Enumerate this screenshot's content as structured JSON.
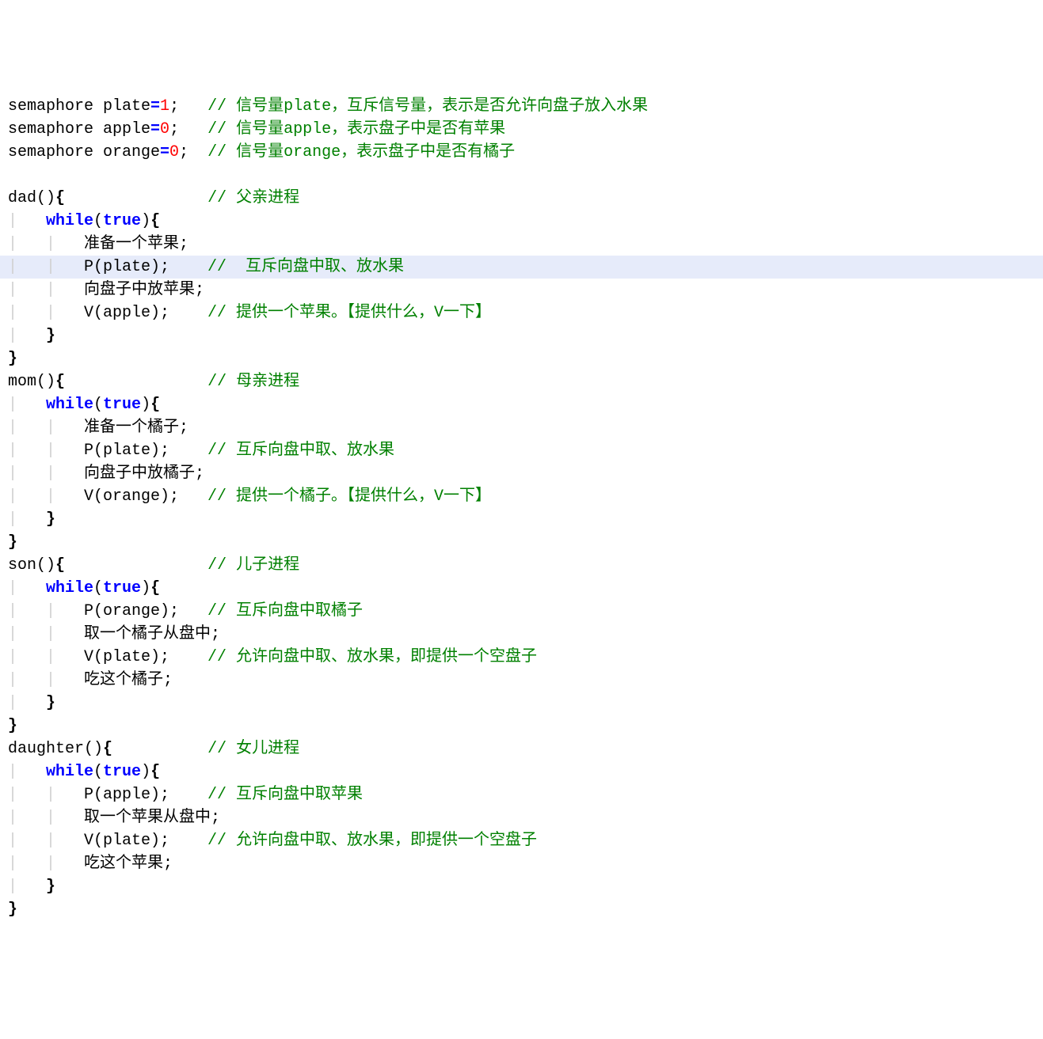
{
  "lines": [
    {
      "indent": 0,
      "highlighted": false,
      "tokens": [
        {
          "t": "identifier",
          "v": "semaphore plate"
        },
        {
          "t": "operator",
          "v": "="
        },
        {
          "t": "number",
          "v": "1"
        },
        {
          "t": "punct",
          "v": ";   "
        },
        {
          "t": "comment",
          "v": "// 信号量plate，互斥信号量，表示是否允许向盘子放入水果"
        }
      ]
    },
    {
      "indent": 0,
      "highlighted": false,
      "tokens": [
        {
          "t": "identifier",
          "v": "semaphore apple"
        },
        {
          "t": "operator",
          "v": "="
        },
        {
          "t": "number",
          "v": "0"
        },
        {
          "t": "punct",
          "v": ";   "
        },
        {
          "t": "comment",
          "v": "// 信号量apple，表示盘子中是否有苹果"
        }
      ]
    },
    {
      "indent": 0,
      "highlighted": false,
      "tokens": [
        {
          "t": "identifier",
          "v": "semaphore orange"
        },
        {
          "t": "operator",
          "v": "="
        },
        {
          "t": "number",
          "v": "0"
        },
        {
          "t": "punct",
          "v": ";  "
        },
        {
          "t": "comment",
          "v": "// 信号量orange，表示盘子中是否有橘子"
        }
      ]
    },
    {
      "indent": 0,
      "highlighted": false,
      "tokens": []
    },
    {
      "indent": 0,
      "highlighted": false,
      "tokens": [
        {
          "t": "identifier",
          "v": "dad"
        },
        {
          "t": "punct",
          "v": "()"
        },
        {
          "t": "brace",
          "v": "{"
        },
        {
          "t": "punct",
          "v": "               "
        },
        {
          "t": "comment",
          "v": "// 父亲进程"
        }
      ]
    },
    {
      "indent": 1,
      "highlighted": false,
      "tokens": [
        {
          "t": "keyword",
          "v": "while"
        },
        {
          "t": "punct",
          "v": "("
        },
        {
          "t": "keyword",
          "v": "true"
        },
        {
          "t": "punct",
          "v": ")"
        },
        {
          "t": "brace",
          "v": "{"
        }
      ]
    },
    {
      "indent": 2,
      "highlighted": false,
      "tokens": [
        {
          "t": "identifier",
          "v": "准备一个苹果;"
        }
      ]
    },
    {
      "indent": 2,
      "highlighted": true,
      "tokens": [
        {
          "t": "identifier",
          "v": "P(plate);    "
        },
        {
          "t": "comment",
          "v": "//  互斥向盘中取、放水果"
        }
      ]
    },
    {
      "indent": 2,
      "highlighted": false,
      "tokens": [
        {
          "t": "identifier",
          "v": "向盘子中放苹果;"
        }
      ]
    },
    {
      "indent": 2,
      "highlighted": false,
      "tokens": [
        {
          "t": "identifier",
          "v": "V(apple);    "
        },
        {
          "t": "comment",
          "v": "// 提供一个苹果。【提供什么，V一下】"
        }
      ]
    },
    {
      "indent": 1,
      "highlighted": false,
      "tokens": [
        {
          "t": "brace",
          "v": "}"
        }
      ]
    },
    {
      "indent": 0,
      "highlighted": false,
      "tokens": [
        {
          "t": "brace",
          "v": "}"
        }
      ]
    },
    {
      "indent": 0,
      "highlighted": false,
      "tokens": [
        {
          "t": "identifier",
          "v": "mom"
        },
        {
          "t": "punct",
          "v": "()"
        },
        {
          "t": "brace",
          "v": "{"
        },
        {
          "t": "punct",
          "v": "               "
        },
        {
          "t": "comment",
          "v": "// 母亲进程"
        }
      ]
    },
    {
      "indent": 1,
      "highlighted": false,
      "tokens": [
        {
          "t": "keyword",
          "v": "while"
        },
        {
          "t": "punct",
          "v": "("
        },
        {
          "t": "keyword",
          "v": "true"
        },
        {
          "t": "punct",
          "v": ")"
        },
        {
          "t": "brace",
          "v": "{"
        }
      ]
    },
    {
      "indent": 2,
      "highlighted": false,
      "tokens": [
        {
          "t": "identifier",
          "v": "准备一个橘子;"
        }
      ]
    },
    {
      "indent": 2,
      "highlighted": false,
      "tokens": [
        {
          "t": "identifier",
          "v": "P(plate);    "
        },
        {
          "t": "comment",
          "v": "// 互斥向盘中取、放水果"
        }
      ]
    },
    {
      "indent": 2,
      "highlighted": false,
      "tokens": [
        {
          "t": "identifier",
          "v": "向盘子中放橘子;"
        }
      ]
    },
    {
      "indent": 2,
      "highlighted": false,
      "tokens": [
        {
          "t": "identifier",
          "v": "V(orange);   "
        },
        {
          "t": "comment",
          "v": "// 提供一个橘子。【提供什么，V一下】"
        }
      ]
    },
    {
      "indent": 1,
      "highlighted": false,
      "tokens": [
        {
          "t": "brace",
          "v": "}"
        }
      ]
    },
    {
      "indent": 0,
      "highlighted": false,
      "tokens": [
        {
          "t": "brace",
          "v": "}"
        }
      ]
    },
    {
      "indent": 0,
      "highlighted": false,
      "tokens": [
        {
          "t": "identifier",
          "v": "son"
        },
        {
          "t": "punct",
          "v": "()"
        },
        {
          "t": "brace",
          "v": "{"
        },
        {
          "t": "punct",
          "v": "               "
        },
        {
          "t": "comment",
          "v": "// 儿子进程"
        }
      ]
    },
    {
      "indent": 1,
      "highlighted": false,
      "tokens": [
        {
          "t": "keyword",
          "v": "while"
        },
        {
          "t": "punct",
          "v": "("
        },
        {
          "t": "keyword",
          "v": "true"
        },
        {
          "t": "punct",
          "v": ")"
        },
        {
          "t": "brace",
          "v": "{"
        }
      ]
    },
    {
      "indent": 2,
      "highlighted": false,
      "tokens": [
        {
          "t": "identifier",
          "v": "P(orange);   "
        },
        {
          "t": "comment",
          "v": "// 互斥向盘中取橘子"
        }
      ]
    },
    {
      "indent": 2,
      "highlighted": false,
      "tokens": [
        {
          "t": "identifier",
          "v": "取一个橘子从盘中;"
        }
      ]
    },
    {
      "indent": 2,
      "highlighted": false,
      "tokens": [
        {
          "t": "identifier",
          "v": "V(plate);    "
        },
        {
          "t": "comment",
          "v": "// 允许向盘中取、放水果，即提供一个空盘子"
        }
      ]
    },
    {
      "indent": 2,
      "highlighted": false,
      "tokens": [
        {
          "t": "identifier",
          "v": "吃这个橘子;"
        }
      ]
    },
    {
      "indent": 1,
      "highlighted": false,
      "tokens": [
        {
          "t": "brace",
          "v": "}"
        }
      ]
    },
    {
      "indent": 0,
      "highlighted": false,
      "tokens": [
        {
          "t": "brace",
          "v": "}"
        }
      ]
    },
    {
      "indent": 0,
      "highlighted": false,
      "tokens": [
        {
          "t": "identifier",
          "v": "daughter"
        },
        {
          "t": "punct",
          "v": "()"
        },
        {
          "t": "brace",
          "v": "{"
        },
        {
          "t": "punct",
          "v": "          "
        },
        {
          "t": "comment",
          "v": "// 女儿进程"
        }
      ]
    },
    {
      "indent": 1,
      "highlighted": false,
      "tokens": [
        {
          "t": "keyword",
          "v": "while"
        },
        {
          "t": "punct",
          "v": "("
        },
        {
          "t": "keyword",
          "v": "true"
        },
        {
          "t": "punct",
          "v": ")"
        },
        {
          "t": "brace",
          "v": "{"
        }
      ]
    },
    {
      "indent": 2,
      "highlighted": false,
      "tokens": [
        {
          "t": "identifier",
          "v": "P(apple);    "
        },
        {
          "t": "comment",
          "v": "// 互斥向盘中取苹果"
        }
      ]
    },
    {
      "indent": 2,
      "highlighted": false,
      "tokens": [
        {
          "t": "identifier",
          "v": "取一个苹果从盘中;"
        }
      ]
    },
    {
      "indent": 2,
      "highlighted": false,
      "tokens": [
        {
          "t": "identifier",
          "v": "V(plate);    "
        },
        {
          "t": "comment",
          "v": "// 允许向盘中取、放水果，即提供一个空盘子"
        }
      ]
    },
    {
      "indent": 2,
      "highlighted": false,
      "tokens": [
        {
          "t": "identifier",
          "v": "吃这个苹果;"
        }
      ]
    },
    {
      "indent": 1,
      "highlighted": false,
      "tokens": [
        {
          "t": "brace",
          "v": "}"
        }
      ]
    },
    {
      "indent": 0,
      "highlighted": false,
      "tokens": [
        {
          "t": "brace",
          "v": "}"
        }
      ]
    }
  ]
}
